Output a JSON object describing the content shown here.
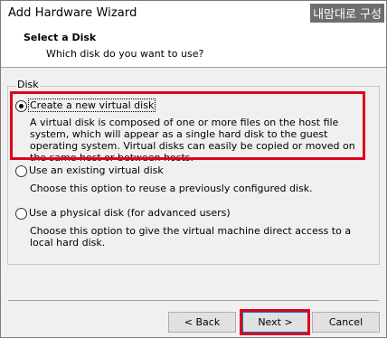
{
  "window": {
    "title": "Add Hardware Wizard",
    "watermark": "내맘대로 구성"
  },
  "header": {
    "title": "Select a Disk",
    "subtitle": "Which disk do you want to use?"
  },
  "group": {
    "label": "Disk",
    "selected": "create-new",
    "options": [
      {
        "label": "Create a new virtual disk",
        "description": "A virtual disk is composed of one or more files on the host file system, which will appear as a single hard disk to the guest operating system. Virtual disks can easily be copied or moved on the same host or between hosts."
      },
      {
        "label": "Use an existing virtual disk",
        "description": "Choose this option to reuse a previously configured disk."
      },
      {
        "label": "Use a physical disk (for advanced users)",
        "description": "Choose this option to give the virtual machine direct access to a local hard disk."
      }
    ]
  },
  "buttons": {
    "back": "< Back",
    "next": "Next >",
    "cancel": "Cancel"
  },
  "colors": {
    "highlight": "#e0001a",
    "background": "#f0f0f0"
  }
}
